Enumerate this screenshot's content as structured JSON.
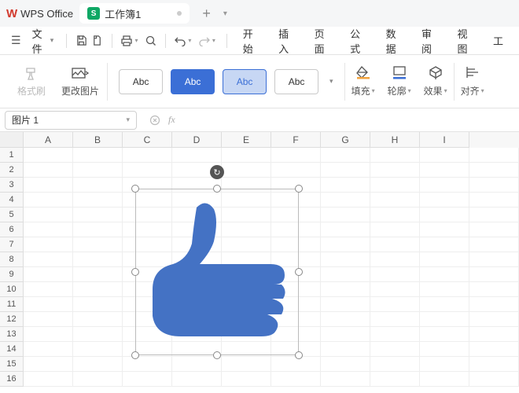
{
  "app": {
    "name": "WPS Office"
  },
  "document": {
    "tab_icon": "S",
    "tab_name": "工作簿1"
  },
  "file_menu": {
    "label": "文件"
  },
  "menu": [
    "开始",
    "插入",
    "页面",
    "公式",
    "数据",
    "审阅",
    "视图",
    "工"
  ],
  "ribbon": {
    "format_painter": "格式刷",
    "change_image": "更改图片",
    "style_samples": [
      "Abc",
      "Abc",
      "Abc",
      "Abc"
    ],
    "fill": "填充",
    "outline": "轮廓",
    "effect": "效果",
    "align": "对齐"
  },
  "name_box": {
    "value": "图片 1"
  },
  "fx": {
    "label": "fx"
  },
  "columns": [
    "A",
    "B",
    "C",
    "D",
    "E",
    "F",
    "G",
    "H",
    "I"
  ],
  "rows": [
    "1",
    "2",
    "3",
    "4",
    "5",
    "6",
    "7",
    "8",
    "9",
    "10",
    "11",
    "12",
    "13",
    "14",
    "15",
    "16"
  ],
  "shape": {
    "fill": "#4472c4"
  }
}
